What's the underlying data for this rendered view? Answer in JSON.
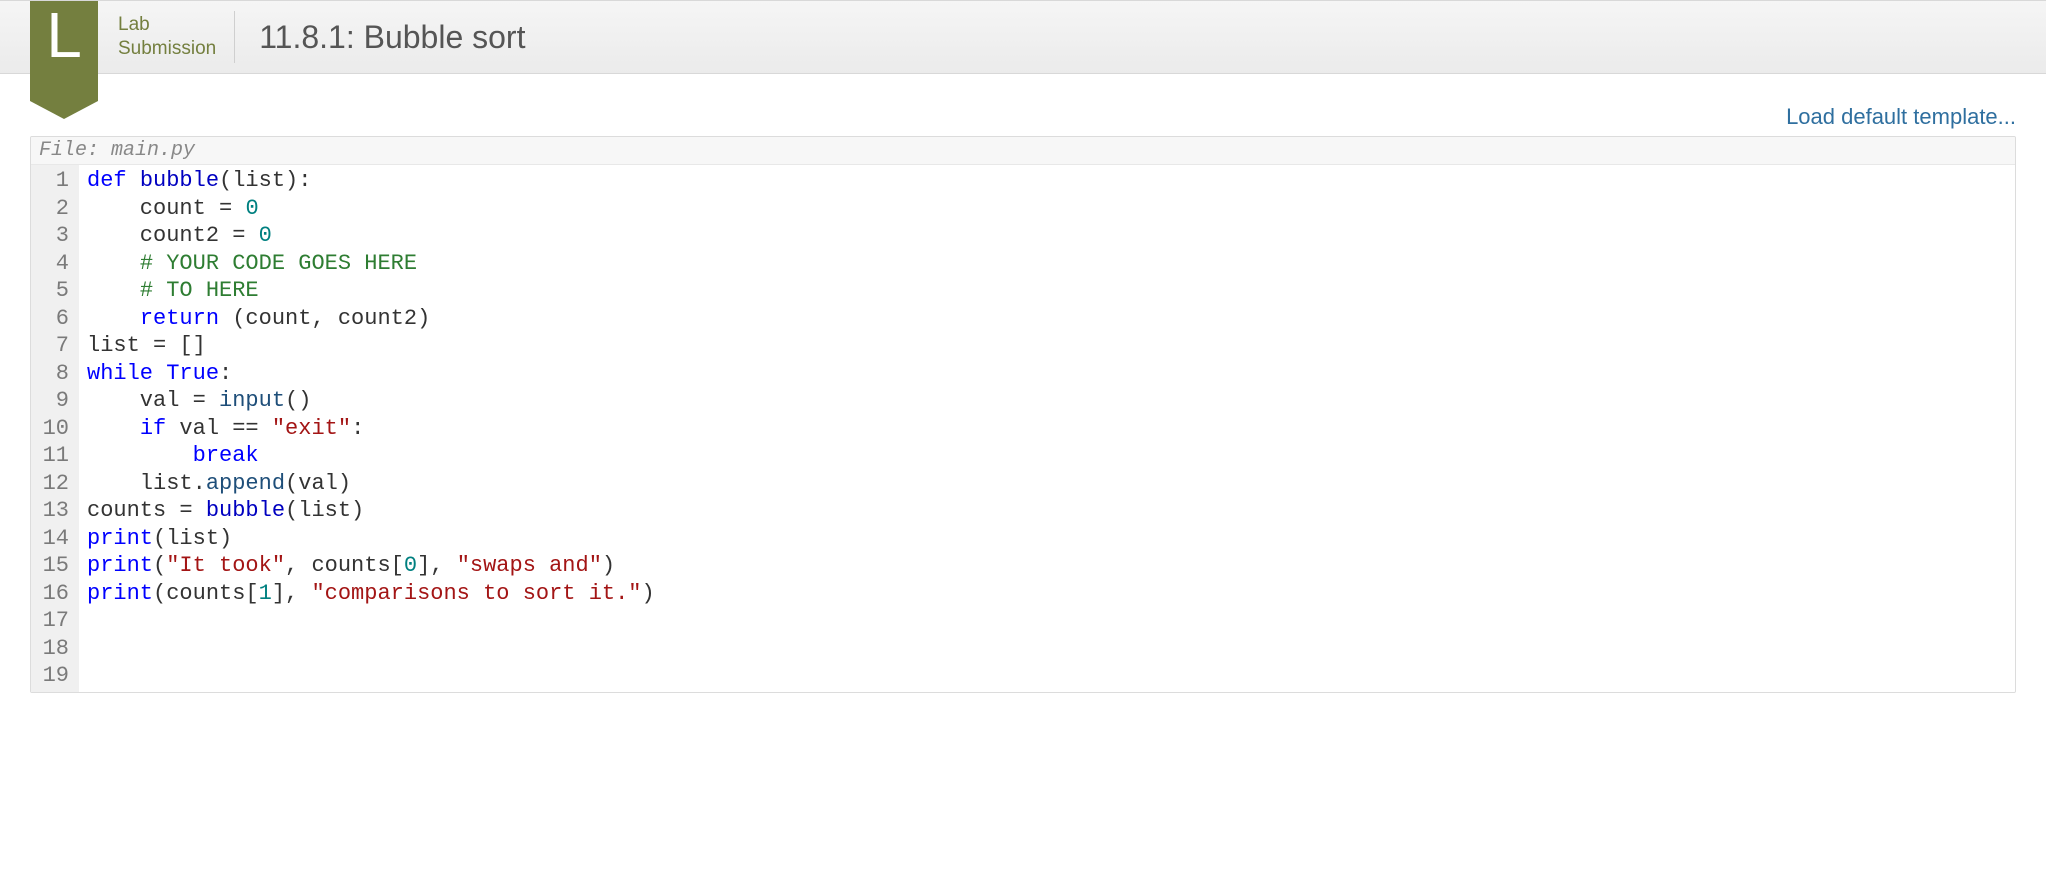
{
  "header": {
    "badge_letter": "L",
    "badge_line1": "Lab",
    "badge_line2": "Submission",
    "title": "11.8.1: Bubble sort"
  },
  "toolbar": {
    "load_template": "Load default template..."
  },
  "editor": {
    "filename_label": "File: main.py",
    "lines": [
      {
        "n": 1,
        "tokens": [
          [
            "kw",
            "def"
          ],
          [
            " "
          ],
          [
            "def",
            "bubble"
          ],
          [
            "",
            "(list):"
          ]
        ]
      },
      {
        "n": 2,
        "tokens": [
          [
            "",
            "    count "
          ],
          [
            "op",
            "="
          ],
          [
            " "
          ],
          [
            "num",
            "0"
          ]
        ]
      },
      {
        "n": 3,
        "tokens": [
          [
            "",
            "    count2 "
          ],
          [
            "op",
            "="
          ],
          [
            " "
          ],
          [
            "num",
            "0"
          ]
        ]
      },
      {
        "n": 4,
        "tokens": [
          [
            "",
            "    "
          ],
          [
            "cmt",
            "# YOUR CODE GOES HERE"
          ]
        ]
      },
      {
        "n": 5,
        "tokens": [
          [
            "",
            ""
          ]
        ]
      },
      {
        "n": 6,
        "tokens": [
          [
            "",
            "    "
          ],
          [
            "cmt",
            "# TO HERE"
          ]
        ]
      },
      {
        "n": 7,
        "tokens": [
          [
            "",
            "    "
          ],
          [
            "kw",
            "return"
          ],
          [
            "",
            " (count, count2)"
          ]
        ]
      },
      {
        "n": 8,
        "tokens": [
          [
            "",
            ""
          ]
        ]
      },
      {
        "n": 9,
        "tokens": [
          [
            "",
            "list "
          ],
          [
            "op",
            "="
          ],
          [
            "",
            " []"
          ]
        ]
      },
      {
        "n": 10,
        "tokens": [
          [
            "kw",
            "while"
          ],
          [
            " "
          ],
          [
            "bool",
            "True"
          ],
          [
            "",
            ":"
          ]
        ]
      },
      {
        "n": 11,
        "tokens": [
          [
            "",
            "    val "
          ],
          [
            "op",
            "="
          ],
          [
            "",
            " "
          ],
          [
            "builtin",
            "input"
          ],
          [
            "",
            "()"
          ]
        ]
      },
      {
        "n": 12,
        "tokens": [
          [
            "",
            "    "
          ],
          [
            "kw",
            "if"
          ],
          [
            "",
            " val "
          ],
          [
            "op",
            "=="
          ],
          [
            "",
            " "
          ],
          [
            "str",
            "\"exit\""
          ],
          [
            "",
            ":"
          ]
        ]
      },
      {
        "n": 13,
        "tokens": [
          [
            "",
            "        "
          ],
          [
            "kw",
            "break"
          ]
        ]
      },
      {
        "n": 14,
        "tokens": [
          [
            "",
            "    list."
          ],
          [
            "builtin",
            "append"
          ],
          [
            "",
            "(val)"
          ]
        ]
      },
      {
        "n": 15,
        "tokens": [
          [
            "",
            ""
          ]
        ]
      },
      {
        "n": 16,
        "tokens": [
          [
            "",
            "counts "
          ],
          [
            "op",
            "="
          ],
          [
            "",
            " "
          ],
          [
            "def",
            "bubble"
          ],
          [
            "",
            "(list)"
          ]
        ]
      },
      {
        "n": 17,
        "tokens": [
          [
            "kw",
            "print"
          ],
          [
            "",
            "(list)"
          ]
        ]
      },
      {
        "n": 18,
        "tokens": [
          [
            "kw",
            "print"
          ],
          [
            "",
            "("
          ],
          [
            "str",
            "\"It took\""
          ],
          [
            "",
            ", counts["
          ],
          [
            "num",
            "0"
          ],
          [
            "",
            "], "
          ],
          [
            "str",
            "\"swaps and\""
          ],
          [
            "",
            ")"
          ]
        ]
      },
      {
        "n": 19,
        "tokens": [
          [
            "kw",
            "print"
          ],
          [
            "",
            "(counts["
          ],
          [
            "num",
            "1"
          ],
          [
            "",
            "], "
          ],
          [
            "str",
            "\"comparisons to sort it.\""
          ],
          [
            "",
            ")"
          ]
        ]
      }
    ]
  }
}
